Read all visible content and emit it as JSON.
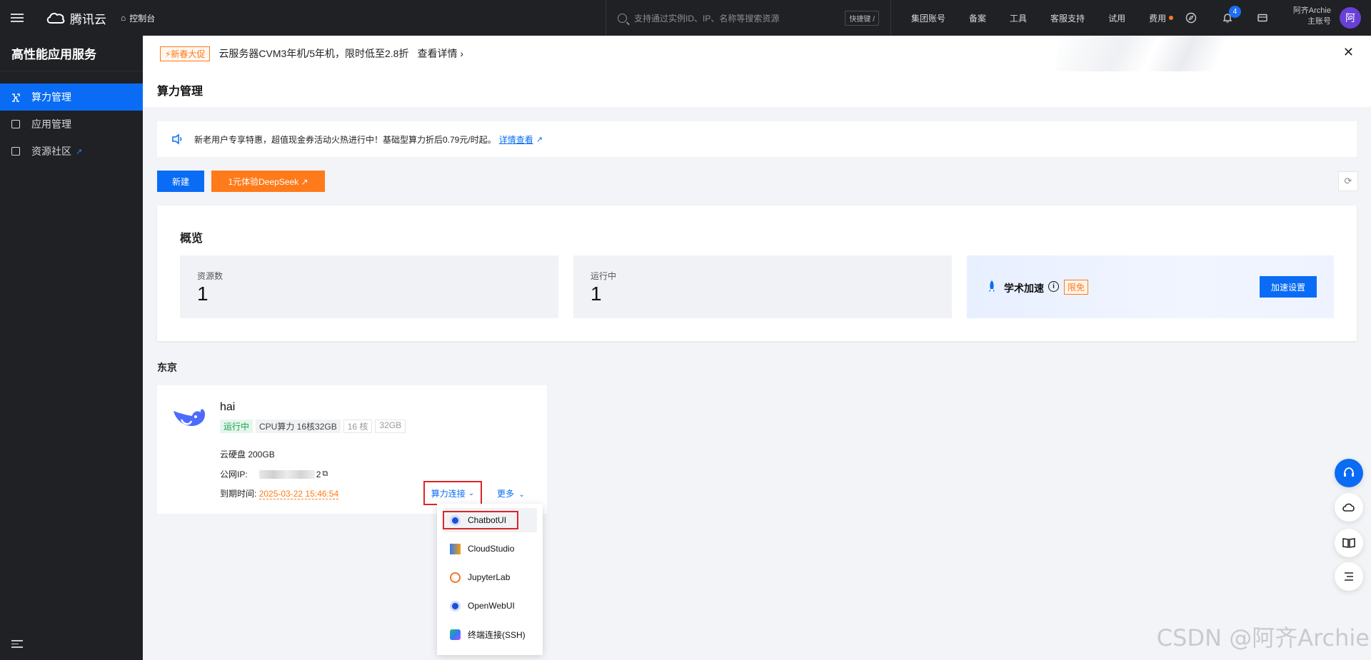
{
  "topbar": {
    "logo_text": "腾讯云",
    "console": "控制台",
    "search_placeholder": "支持通过实例ID、IP、名称等搜索资源",
    "shortcut": "快捷键 /",
    "links": [
      "集团账号",
      "备案",
      "工具",
      "客服支持",
      "试用",
      "费用"
    ],
    "notification_count": "4",
    "user_name": "阿齐Archie",
    "user_role": "主账号",
    "avatar_text": "阿"
  },
  "sidebar": {
    "title": "高性能应用服务",
    "items": [
      {
        "label": "算力管理",
        "active": true
      },
      {
        "label": "应用管理",
        "active": false
      },
      {
        "label": "资源社区",
        "active": false
      }
    ]
  },
  "promo": {
    "tag": "⚡新春大促",
    "text": "云服务器CVM3年机/5年机，限时低至2.8折",
    "more": "查看详情 ›",
    "close": "✕"
  },
  "page": {
    "title": "算力管理"
  },
  "notice": {
    "text": "新老用户专享特惠，超值现金券活动火热进行中！基础型算力折后0.79元/时起。",
    "link": "详情查看"
  },
  "actions": {
    "new_label": "新建",
    "deepseek_label": "1元体验DeepSeek ↗"
  },
  "overview": {
    "title": "概览",
    "resources_label": "资源数",
    "resources_value": "1",
    "running_label": "运行中",
    "running_value": "1",
    "accel_name": "学术加速",
    "accel_tag": "限免",
    "accel_button": "加速设置"
  },
  "region": "东京",
  "instance": {
    "name": "hai",
    "status": "运行中",
    "spec": "CPU算力 16核32GB",
    "cores": "16 核",
    "memory": "32GB",
    "disk": "云硬盘 200GB",
    "ip_label": "公网IP:",
    "ip_suffix": "2",
    "expire_label": "到期时间:",
    "expire_value": "2025-03-22 15:46:54",
    "connect_label": "算力连接",
    "more_label": "更多"
  },
  "dropdown": {
    "items": [
      "ChatbotUI",
      "CloudStudio",
      "JupyterLab",
      "OpenWebUI",
      "终端连接(SSH)"
    ]
  },
  "watermark": "CSDN @阿齐Archie",
  "colors": {
    "primary": "#0a6cf5",
    "orange": "#ff7a1a",
    "dark": "#1f2124",
    "highlight_red": "#e02424"
  }
}
